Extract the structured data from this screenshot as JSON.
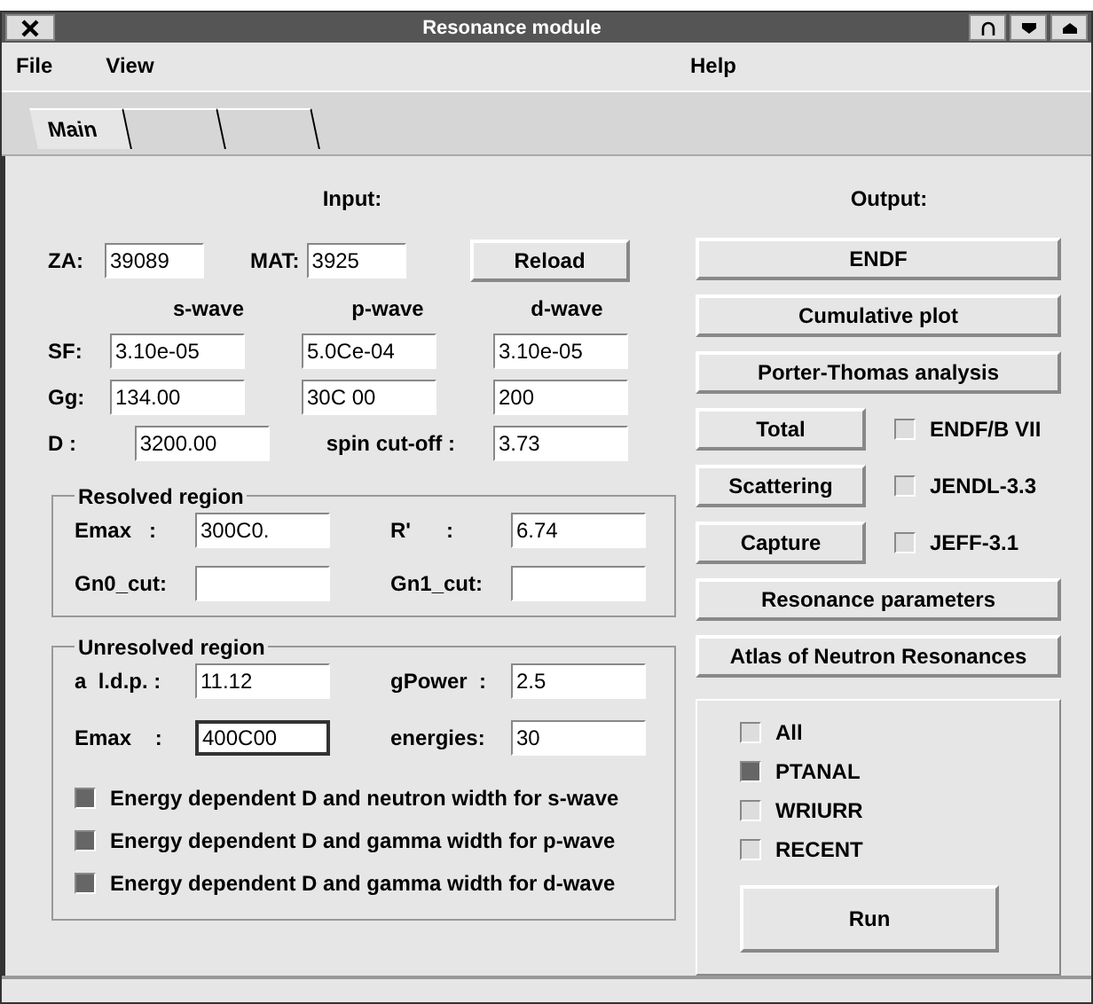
{
  "window": {
    "title": "Resonance module"
  },
  "menu": {
    "left": [
      "File",
      "View"
    ],
    "right": "Help"
  },
  "tabs": [
    {
      "label": "Main",
      "selected": true
    },
    {
      "selected": false
    },
    {
      "selected": false
    }
  ],
  "input": {
    "heading": "Input:",
    "za": {
      "label": "ZA:",
      "value": "39089"
    },
    "mat": {
      "label": "MAT:",
      "value": "3925"
    },
    "reload": "Reload",
    "waves": [
      "s-wave",
      "p-wave",
      "d-wave"
    ],
    "rows": [
      {
        "label": "SF:",
        "values": [
          "3.10e-05",
          "5.0Ce-04",
          "3.10e-05"
        ]
      },
      {
        "label": "Gg:",
        "values": [
          "134.00",
          "30C 00",
          "200"
        ]
      },
      {
        "label": "D :",
        "values": [
          "3200.00"
        ],
        "extra_label": "spin cut-off :",
        "extra_value": "3.73"
      }
    ]
  },
  "resolved": {
    "title": "Resolved region",
    "fields": [
      {
        "label": "Emax   :",
        "value": "300C0."
      },
      {
        "label": "R'      :",
        "value": "6.74"
      },
      {
        "label": "Gn0_cut:"
      },
      {
        "label": "Gn1_cut:"
      }
    ]
  },
  "unresolved": {
    "title": "Unresolved region",
    "fields": [
      {
        "label": "a  l.d.p. :",
        "value": "11.12",
        "focused": false
      },
      {
        "label": "gPower  :",
        "value": "2.5",
        "focused": false
      },
      {
        "label": "Emax    :",
        "value": "400C00",
        "focused": true
      },
      {
        "label": "energies:",
        "value": "30",
        "focused": false
      }
    ],
    "checks": [
      {
        "label": "Energy dependent D and neutron width for s-wave",
        "checked": true
      },
      {
        "label": "Energy dependent D and gamma width for p-wave",
        "checked": true
      },
      {
        "label": "Energy dependent D and gamma width for d-wave",
        "checked": true
      }
    ]
  },
  "output": {
    "heading": "Output:",
    "top_buttons": [
      "ENDF",
      "Cumulative plot",
      "Porter-Thomas analysis"
    ],
    "pairs": [
      {
        "button": "Total",
        "check": "ENDF/B VII",
        "checked": false
      },
      {
        "button": "Scattering",
        "check": "JENDL-3.3",
        "checked": false
      },
      {
        "button": "Capture",
        "check": "JEFF-3.1",
        "checked": false
      }
    ],
    "bottom_buttons": [
      "Resonance parameters",
      "Atlas of Neutron Resonances"
    ],
    "options": [
      {
        "label": "All",
        "checked": false
      },
      {
        "label": "PTANAL",
        "checked": true
      },
      {
        "label": "WRIURR",
        "checked": false
      },
      {
        "label": "RECENT",
        "checked": false
      }
    ],
    "run": "Run"
  }
}
